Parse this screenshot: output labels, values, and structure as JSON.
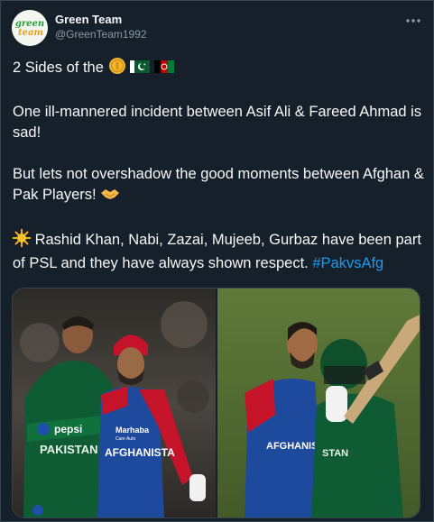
{
  "account": {
    "display_name": "Green Team",
    "handle": "@GreenTeam1992",
    "avatar_text_line1": "green",
    "avatar_text_line2": "team"
  },
  "tweet": {
    "line1_text": "2 Sides of the",
    "line1_emojis": [
      "coin-icon",
      "pakistan-flag-icon",
      "afghanistan-flag-icon"
    ],
    "para2": "One ill-mannered incident between Asif Ali & Fareed Ahmad is sad!",
    "para3_text": "But lets not overshadow the good moments between Afghan & Pak Players!",
    "para3_emoji": "handshake-icon",
    "para4_text": "Rashid Khan, Nabi, Zazai, Mujeeb, Gurbaz have been part of PSL and they have always shown respect.",
    "para4_emoji": "sun-icon",
    "hashtag": "#PakvsAfg"
  },
  "media": {
    "left_photo": {
      "shirt_text_left": "PAKISTAN",
      "shirt_text_right": "AFGHANISTA",
      "sponsor": "Marhaba",
      "sponsor_sub": "Care Auto"
    },
    "right_photo": {
      "shirt_text_left": "AFGHANIS",
      "shirt_text_right": "STAN"
    }
  },
  "colors": {
    "background": "#15202b",
    "text": "#f7f9f9",
    "muted": "#8b98a5",
    "link": "#1d9bf0",
    "border": "#38444d"
  }
}
